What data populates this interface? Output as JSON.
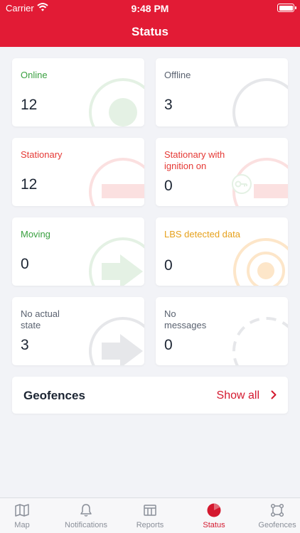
{
  "status_bar": {
    "carrier": "Carrier",
    "time": "9:48 PM"
  },
  "header": {
    "title": "Status"
  },
  "cards": [
    {
      "label": "Online",
      "count": "12",
      "label_color": "#3aa040"
    },
    {
      "label": "Offline",
      "count": "3",
      "label_color": "#5a6270"
    },
    {
      "label": "Stationary",
      "count": "12",
      "label_color": "#e53935"
    },
    {
      "label": "Stationary with ignition on",
      "count": "0",
      "label_color": "#e53935"
    },
    {
      "label": "Moving",
      "count": "0",
      "label_color": "#3aa040"
    },
    {
      "label": "LBS detected data",
      "count": "0",
      "label_color": "#e6a11c"
    },
    {
      "label": "No actual state",
      "count": "3",
      "label_color": "#5a6270"
    },
    {
      "label": "No messages",
      "count": "0",
      "label_color": "#5a6270"
    }
  ],
  "geofences": {
    "title": "Geofences",
    "show_all": "Show all"
  },
  "tabs": [
    {
      "label": "Map",
      "icon": "map-icon"
    },
    {
      "label": "Notifications",
      "icon": "bell-icon"
    },
    {
      "label": "Reports",
      "icon": "reports-icon"
    },
    {
      "label": "Status",
      "icon": "status-pie-icon",
      "active": true
    },
    {
      "label": "Geofences",
      "icon": "geofence-icon"
    }
  ],
  "colors": {
    "brand": "#e21b35",
    "accent": "#d4192f",
    "online": "#3aa040",
    "warning": "#e6a11c"
  }
}
